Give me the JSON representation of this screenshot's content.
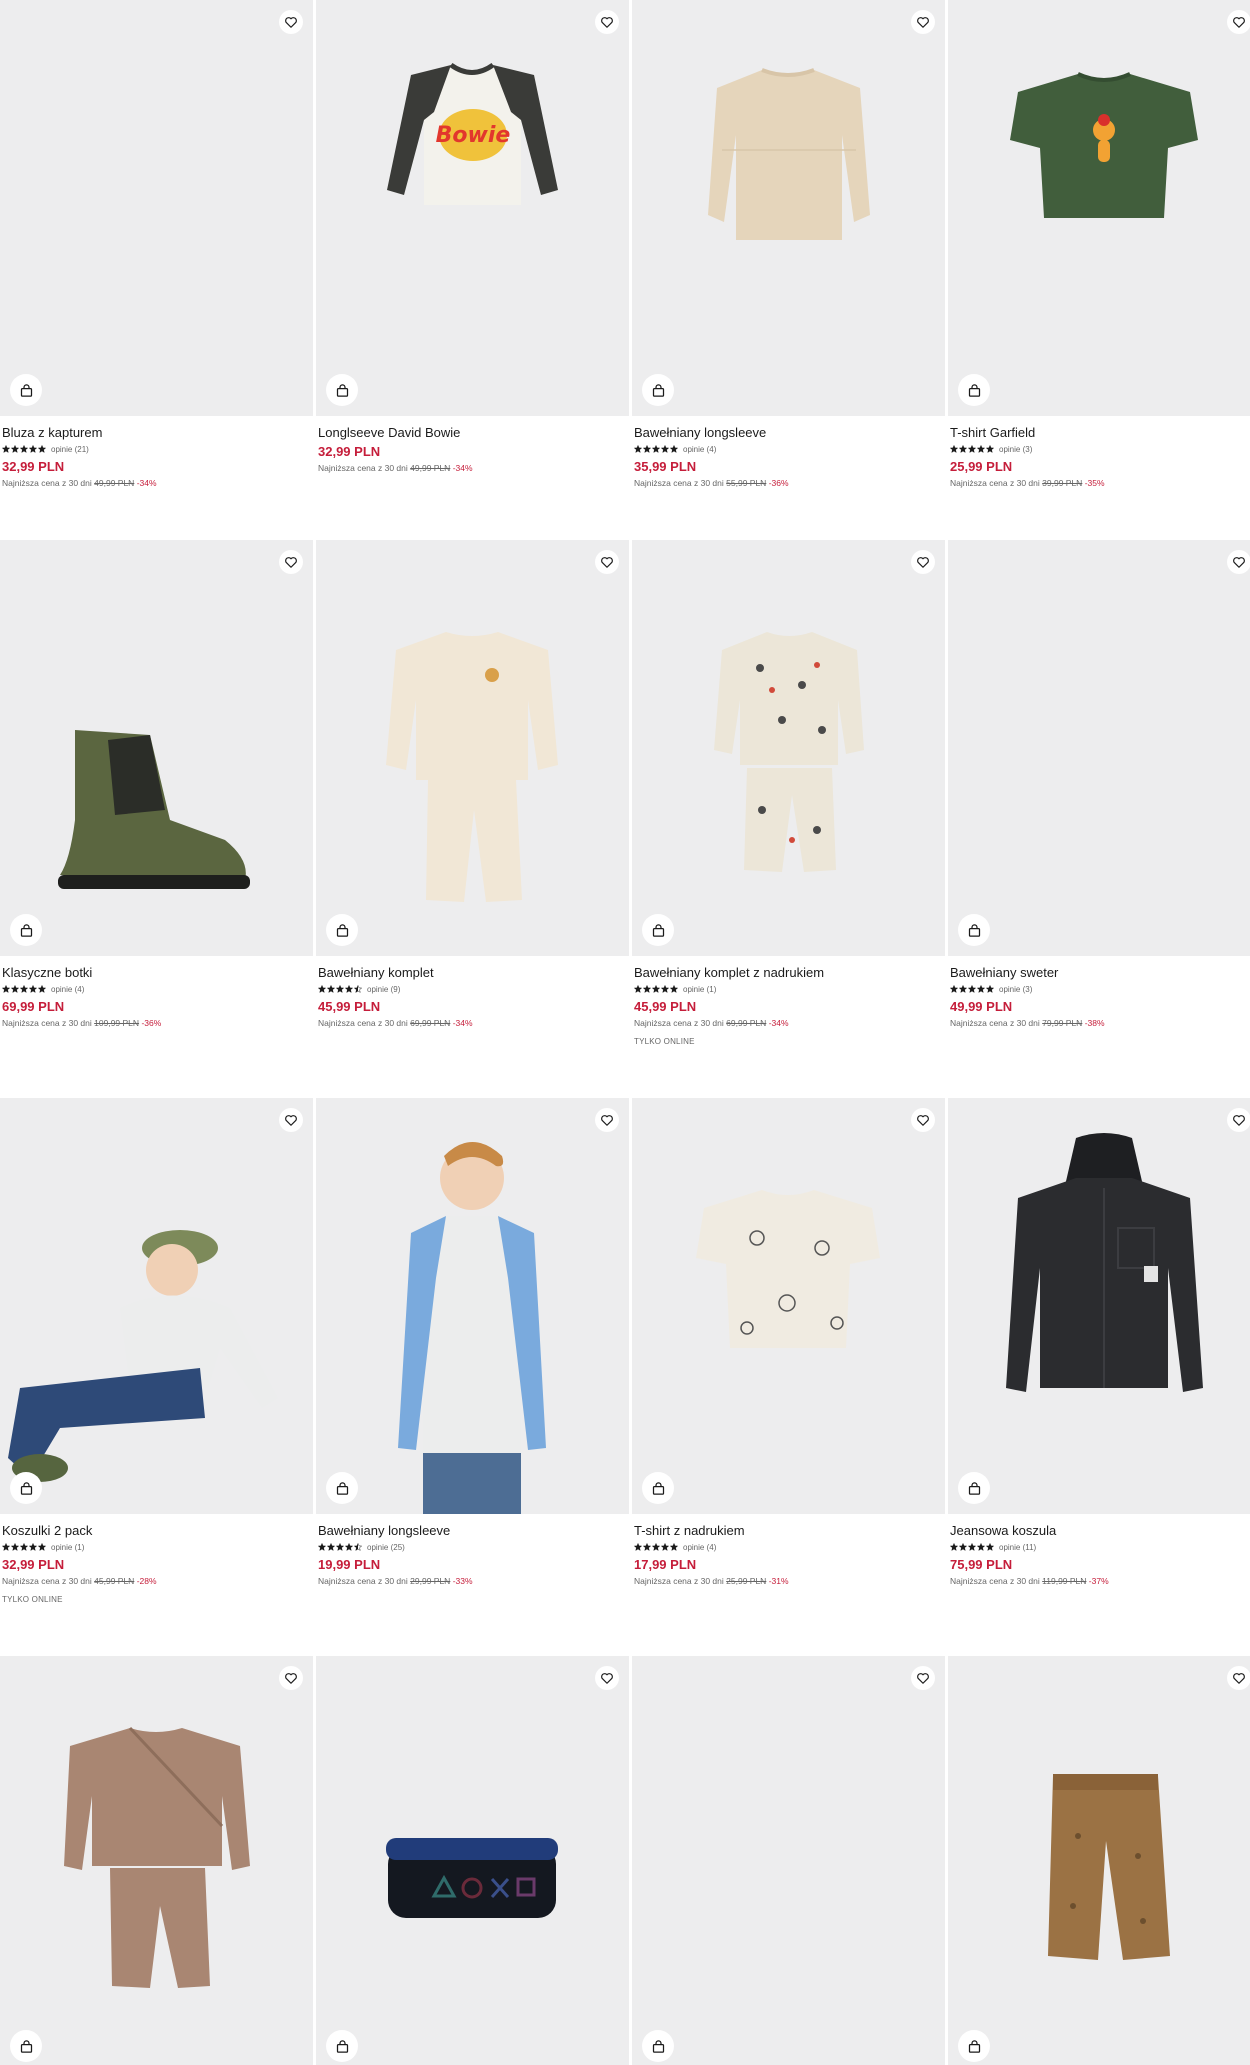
{
  "review_word": "opinie",
  "lowest_price_label": "Najniższa cena z 30 dni",
  "colors": {
    "accent": "#c51d3a",
    "tile_bg": "#ededee"
  },
  "products": [
    {
      "name": "Bluza z kapturem",
      "rating": 5,
      "reviews": "opinie (21)",
      "price": "32,99 PLN",
      "lowest_label": "Najniższa cena z 30 dni",
      "old_price": "49,99 PLN",
      "discount": "-34%",
      "badge": "",
      "art": "empty"
    },
    {
      "name": "Longlseeve David Bowie",
      "rating": 0,
      "reviews": "",
      "price": "32,99 PLN",
      "lowest_label": "Najniższa cena z 30 dni",
      "old_price": "49,99 PLN",
      "discount": "-34%",
      "badge": "",
      "art": "bowie"
    },
    {
      "name": "Bawełniany longsleeve",
      "rating": 5,
      "reviews": "opinie (4)",
      "price": "35,99 PLN",
      "lowest_label": "Najniższa cena z 30 dni",
      "old_price": "55,99 PLN",
      "discount": "-36%",
      "badge": "",
      "art": "beige-sweat"
    },
    {
      "name": "T-shirt Garfield",
      "rating": 5,
      "reviews": "opinie (3)",
      "price": "25,99 PLN",
      "lowest_label": "Najniższa cena z 30 dni",
      "old_price": "39,99 PLN",
      "discount": "-35%",
      "badge": "",
      "art": "green-tee"
    },
    {
      "name": "Klasyczne botki",
      "rating": 5,
      "reviews": "opinie (4)",
      "price": "69,99 PLN",
      "lowest_label": "Najniższa cena z 30 dni",
      "old_price": "109,99 PLN",
      "discount": "-36%",
      "badge": "",
      "art": "boot"
    },
    {
      "name": "Bawełniany komplet",
      "rating": 4.5,
      "reviews": "opinie (9)",
      "price": "45,99 PLN",
      "lowest_label": "Najniższa cena z 30 dni",
      "old_price": "69,99 PLN",
      "discount": "-34%",
      "badge": "",
      "art": "cream-set"
    },
    {
      "name": "Bawełniany komplet z nadrukiem",
      "rating": 5,
      "reviews": "opinie (1)",
      "price": "45,99 PLN",
      "lowest_label": "Najniższa cena z 30 dni",
      "old_price": "69,99 PLN",
      "discount": "-34%",
      "badge": "TYLKO ONLINE",
      "art": "print-set"
    },
    {
      "name": "Bawełniany sweter",
      "rating": 5,
      "reviews": "opinie (3)",
      "price": "49,99 PLN",
      "lowest_label": "Najniższa cena z 30 dni",
      "old_price": "79,99 PLN",
      "discount": "-38%",
      "badge": "",
      "art": "empty"
    },
    {
      "name": "Koszulki 2 pack",
      "rating": 5,
      "reviews": "opinie (1)",
      "price": "32,99 PLN",
      "lowest_label": "Najniższa cena z 30 dni",
      "old_price": "45,99 PLN",
      "discount": "-28%",
      "badge": "TYLKO ONLINE",
      "art": "kid-cap"
    },
    {
      "name": "Bawełniany longsleeve",
      "rating": 4.5,
      "reviews": "opinie (25)",
      "price": "19,99 PLN",
      "lowest_label": "Najniższa cena z 30 dni",
      "old_price": "29,99 PLN",
      "discount": "-33%",
      "badge": "",
      "art": "kid-raglan"
    },
    {
      "name": "T-shirt z nadrukiem",
      "rating": 5,
      "reviews": "opinie (4)",
      "price": "17,99 PLN",
      "lowest_label": "Najniższa cena z 30 dni",
      "old_price": "25,99 PLN",
      "discount": "-31%",
      "badge": "",
      "art": "print-tee"
    },
    {
      "name": "Jeansowa koszula",
      "rating": 5,
      "reviews": "opinie (11)",
      "price": "75,99 PLN",
      "lowest_label": "Najniższa cena z 30 dni",
      "old_price": "119,99 PLN",
      "discount": "-37%",
      "badge": "",
      "art": "denim-shirt"
    },
    {
      "name": "",
      "rating": 0,
      "reviews": "",
      "price": "",
      "lowest_label": "",
      "old_price": "",
      "discount": "",
      "badge": "",
      "art": "wrap-set"
    },
    {
      "name": "",
      "rating": 0,
      "reviews": "",
      "price": "",
      "lowest_label": "",
      "old_price": "",
      "discount": "",
      "badge": "",
      "art": "bag-ps"
    },
    {
      "name": "",
      "rating": 0,
      "reviews": "",
      "price": "",
      "lowest_label": "",
      "old_price": "",
      "discount": "",
      "badge": "",
      "art": "empty"
    },
    {
      "name": "",
      "rating": 0,
      "reviews": "",
      "price": "",
      "lowest_label": "",
      "old_price": "",
      "discount": "",
      "badge": "",
      "art": "brown-pants"
    }
  ]
}
